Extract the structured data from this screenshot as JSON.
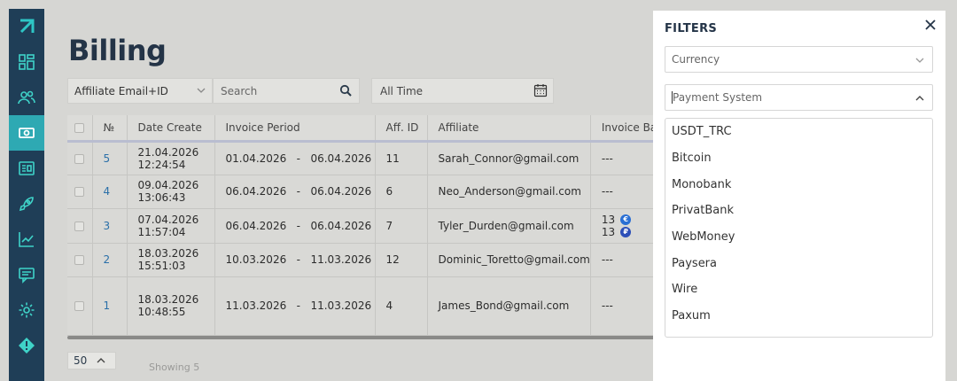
{
  "page": {
    "title": "Billing"
  },
  "sidebar": {
    "items": [
      {
        "icon": "logo-arrow-icon",
        "active": false
      },
      {
        "icon": "dashboard-icon",
        "active": false
      },
      {
        "icon": "users-icon",
        "active": false
      },
      {
        "icon": "billing-icon",
        "active": true
      },
      {
        "icon": "id-card-icon",
        "active": false
      },
      {
        "icon": "rocket-icon",
        "active": false
      },
      {
        "icon": "chart-icon",
        "active": false
      },
      {
        "icon": "messages-icon",
        "active": false
      },
      {
        "icon": "settings-icon",
        "active": false
      },
      {
        "icon": "alert-icon",
        "active": false
      }
    ]
  },
  "toolbar": {
    "affiliate_select": "Affiliate Email+ID",
    "search_placeholder": "Search",
    "time_select": "All Time"
  },
  "table": {
    "headers": [
      "№",
      "Date Create",
      "Invoice Period",
      "Aff. ID",
      "Affiliate",
      "Invoice Bala"
    ],
    "rows": [
      {
        "num": "5",
        "date": "21.04.2026",
        "time": "12:24:54",
        "period_from": "01.04.2026",
        "period_to": "06.04.2026",
        "aff_id": "11",
        "affiliate": "Sarah_Connor@gmail.com",
        "balance": "---"
      },
      {
        "num": "4",
        "date": "09.04.2026",
        "time": "13:06:43",
        "period_from": "06.04.2026",
        "period_to": "06.04.2026",
        "aff_id": "6",
        "affiliate": "Neo_Anderson@gmail.com",
        "balance": "---"
      },
      {
        "num": "3",
        "date": "07.04.2026",
        "time": "11:57:04",
        "period_from": "06.04.2026",
        "period_to": "06.04.2026",
        "aff_id": "7",
        "affiliate": "Tyler_Durden@gmail.com",
        "balance_lines": [
          {
            "value": "13",
            "coin": "€"
          },
          {
            "value": "13",
            "coin": "₽"
          }
        ]
      },
      {
        "num": "2",
        "date": "18.03.2026",
        "time": "15:51:03",
        "period_from": "10.03.2026",
        "period_to": "11.03.2026",
        "aff_id": "12",
        "affiliate": "Dominic_Toretto@gmail.com",
        "balance": "---"
      },
      {
        "num": "1",
        "date": "18.03.2026",
        "time": "10:48:55",
        "period_from": "11.03.2026",
        "period_to": "11.03.2026",
        "aff_id": "4",
        "affiliate": "James_Bond@gmail.com",
        "balance": "---"
      }
    ],
    "dash": "-"
  },
  "footer": {
    "per_page": "50",
    "showing": "Showing 5"
  },
  "filters": {
    "title": "FILTERS",
    "currency_placeholder": "Currency",
    "payment_placeholder": "Payment System",
    "payment_options": [
      "USDT_TRC",
      "Bitcoin",
      "Monobank",
      "PrivatBank",
      "WebMoney",
      "Paysera",
      "Wire",
      "Paxum"
    ]
  },
  "colors": {
    "sidebar": "#1f3e57",
    "accent": "#2ea9b3",
    "link": "#2a6fa8"
  }
}
